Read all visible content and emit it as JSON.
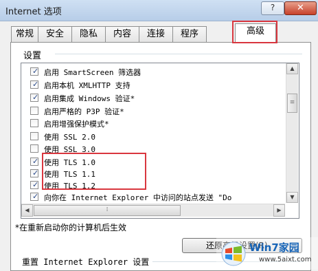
{
  "window": {
    "title": "Internet 选项",
    "help_label": "?",
    "close_label": "✕"
  },
  "tabs": [
    {
      "label": "常规"
    },
    {
      "label": "安全"
    },
    {
      "label": "隐私"
    },
    {
      "label": "内容"
    },
    {
      "label": "连接"
    },
    {
      "label": "程序"
    },
    {
      "label": "高级",
      "active": true
    }
  ],
  "settings": {
    "section_label": "设置",
    "items": [
      {
        "label": "启用 SmartScreen 筛选器",
        "checked": true
      },
      {
        "label": "启用本机 XMLHTTP 支持",
        "checked": true
      },
      {
        "label": "启用集成 Windows 验证*",
        "checked": true
      },
      {
        "label": "启用严格的 P3P 验证*",
        "checked": false
      },
      {
        "label": "启用增强保护模式*",
        "checked": false
      },
      {
        "label": "使用 SSL 2.0",
        "checked": false
      },
      {
        "label": "使用 SSL 3.0",
        "checked": false
      },
      {
        "label": "使用 TLS 1.0",
        "checked": true
      },
      {
        "label": "使用 TLS 1.1",
        "checked": true
      },
      {
        "label": "使用 TLS 1.2",
        "checked": true
      },
      {
        "label": "向你在 Internet Explorer 中访问的站点发送 \"Do",
        "checked": true
      }
    ],
    "restart_note": "*在重新启动你的计算机后生效",
    "restore_button": "还原高级设置(R)",
    "reset_section": "重置 Internet Explorer 设置"
  },
  "watermark": {
    "title": "Win7家园",
    "url": "www.5aixt.com"
  },
  "colors": {
    "highlight": "#d9363e",
    "titlebar": "#b7cde8",
    "checkmark": "#2a4a8a"
  }
}
